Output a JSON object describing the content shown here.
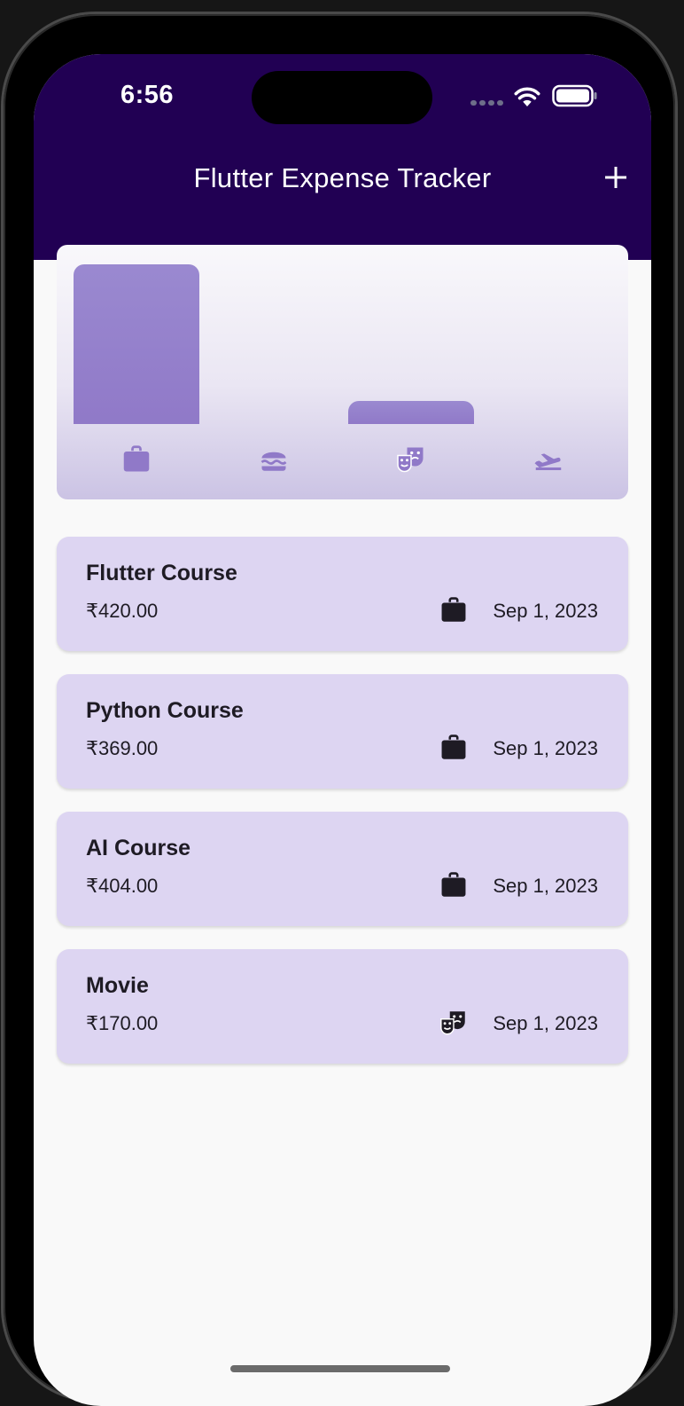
{
  "status_bar": {
    "time": "6:56"
  },
  "app_bar": {
    "title": "Flutter Expense Tracker",
    "add_icon": "plus-icon"
  },
  "colors": {
    "app_bar_bg": "#210053",
    "bar_fill": "#9079c8",
    "card_bg": "#ddd5f2",
    "icon_dark": "#1e1b24"
  },
  "chart_data": {
    "type": "bar",
    "categories": [
      "work",
      "food",
      "leisure",
      "travel"
    ],
    "category_icons": [
      "briefcase-icon",
      "burger-icon",
      "theater-masks-icon",
      "flight-takeoff-icon"
    ],
    "values": [
      1193,
      0,
      170,
      0
    ],
    "ylim": [
      0,
      1193
    ]
  },
  "expenses": [
    {
      "title": "Flutter Course",
      "amount": "₹420.00",
      "category_icon": "briefcase-icon",
      "date": "Sep 1, 2023"
    },
    {
      "title": "Python Course",
      "amount": "₹369.00",
      "category_icon": "briefcase-icon",
      "date": "Sep 1, 2023"
    },
    {
      "title": "AI Course",
      "amount": "₹404.00",
      "category_icon": "briefcase-icon",
      "date": "Sep 1, 2023"
    },
    {
      "title": "Movie",
      "amount": "₹170.00",
      "category_icon": "theater-masks-icon",
      "date": "Sep 1, 2023"
    }
  ]
}
